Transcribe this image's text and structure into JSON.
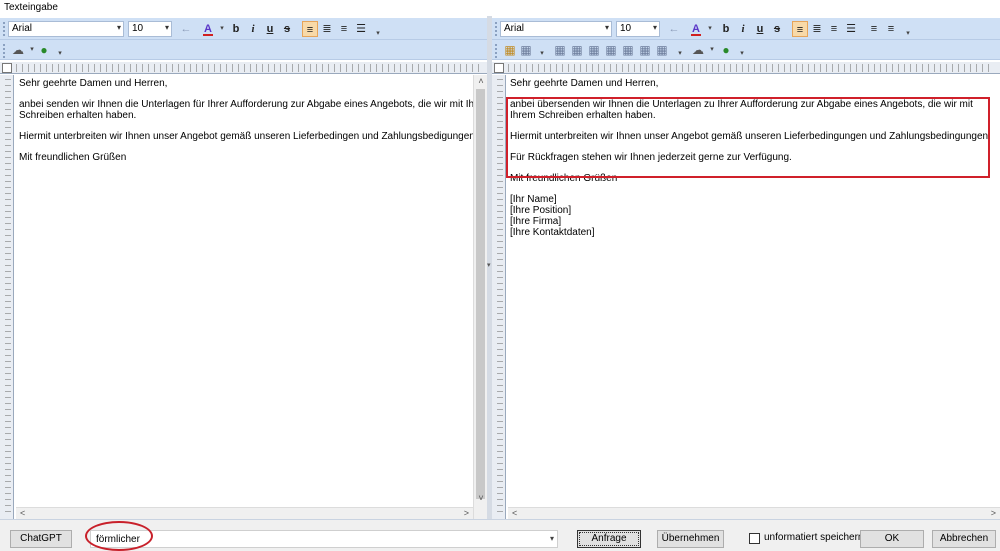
{
  "window": {
    "title": "Texteingabe"
  },
  "toolbar": {
    "font_name": "Arial",
    "font_size": "10",
    "icons": {
      "back": "←",
      "font_color": "A",
      "bold": "b",
      "italic": "i",
      "underline": "u",
      "strike": "s",
      "align_left": "≡",
      "align_center": "≣",
      "align_right": "≡",
      "justify": "☰",
      "bullet_list": "≡",
      "num_list": "≡",
      "overflow": "▾",
      "cloud": "☁",
      "globe": "●",
      "table": "▦",
      "dropdown": "▾"
    }
  },
  "left_doc": {
    "salutation": "Sehr geehrte Damen und Herren,",
    "line1": "anbei senden wir Ihnen die Unterlagen für Ihrer Aufforderung zur Abgabe eines Angebots, die wir mit Ihrer",
    "line2": "Schreiben erhalten haben.",
    "para2": "Hiermit unterbreiten wir Ihnen unser Angebot gemäß unseren Lieferbedingen und Zahlungsbedigungen.",
    "closing": "Mit freundlichen Grüßen"
  },
  "right_doc": {
    "salutation": "Sehr geehrte Damen und Herren,",
    "line1": "anbei übersenden wir Ihnen die Unterlagen zu Ihrer Aufforderung zur Abgabe eines Angebots, die wir mit",
    "line2": "Ihrem Schreiben erhalten haben.",
    "para2": "Hiermit unterbreiten wir Ihnen unser Angebot gemäß unseren Lieferbedingungen und Zahlungsbedingungen.",
    "para3": "Für Rückfragen stehen wir Ihnen jederzeit gerne zur Verfügung.",
    "closing": "Mit freundlichen Grüßen",
    "sig_name": "[Ihr Name]",
    "sig_position": "[Ihre Position]",
    "sig_company": "[Ihre Firma]",
    "sig_contact": "[Ihre Kontaktdaten]"
  },
  "scroll": {
    "up": "˄",
    "down": "˅",
    "left": "<",
    "right": ">"
  },
  "bottom": {
    "chatgpt_label": "ChatGPT",
    "prompt_value": "förmlicher",
    "request_label": "Anfrage",
    "apply_label": "Übernehmen",
    "unformatted_label": "unformatiert speichern",
    "ok_label": "OK",
    "cancel_label": "Abbrechen"
  },
  "colors": {
    "annotation": "#d0202a",
    "toolbar_bg": "#cfe0f5",
    "selected_btn": "#f8d9a8"
  }
}
